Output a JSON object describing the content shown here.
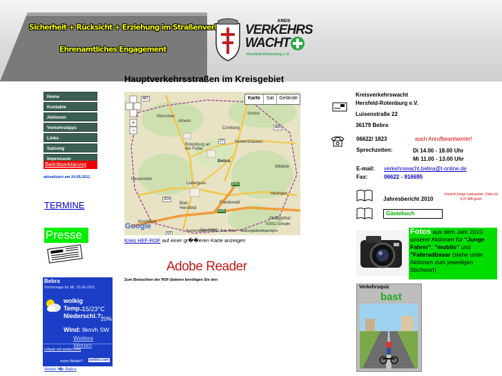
{
  "banner": {
    "slogan_line1": "Sicherheit + Rücksicht + Erziehung im Straßenverkehr",
    "slogan_line2": "Ehrenamtliches Engagement",
    "logo": {
      "small_text": "KREIS",
      "word1": "VERKEHRS",
      "word2": "WACHT",
      "sub": "Hersfeld-Rotenburg e.V.",
      "accent": "#2ea84a",
      "brand": "#1a1a1a"
    }
  },
  "nav": {
    "items": [
      "Home",
      "Kontakte",
      "Aktionen",
      "Verkehrstipps",
      "Links",
      "Satzung",
      "Impressum"
    ],
    "beitritt": "Beitrittserklärung",
    "updated": "aktualisiert am 24.05.2011",
    "termine": "TERMINE",
    "presse": "Presse"
  },
  "weather": {
    "city": "Bebra",
    "forecast_title": "Vorhersage für Mi. 15.06.2011",
    "condition": "wolkig",
    "temp_label": "Temp.:",
    "temp_value": "15/23°C",
    "rain_label": "Niederschl.?:",
    "rain_value": "20%",
    "wind_label": "Wind:",
    "wind_value": "9km/h SW",
    "more_link": "Weitere Werte»",
    "urlaub_link": "Urlaub mit wetter.com",
    "more_weather": "mehr Wetter?",
    "brand": "wetter.com",
    "footer_link": "Wetter f�r Bebra"
  },
  "main": {
    "title": "Hauptverkehrsstraßen im Kreisgebiet",
    "map": {
      "buttons": [
        "Karte",
        "Sat",
        "Gelände"
      ],
      "places": [
        "Morschen",
        "Alheim",
        "Sontra",
        "Cornberg",
        "Nentershausen",
        "Rotenburg an der Fulda",
        "Bebra",
        "Neuenstein",
        "Ludwigsau",
        "Bad Hersfeld",
        "Friedewald",
        "Wildeck",
        "Heringen",
        "Philippsthal",
        "Kirchheim",
        "Haunetal"
      ],
      "roads": [
        "487",
        "27",
        "400",
        "324",
        "E45",
        "E40",
        "62",
        "7",
        "4"
      ],
      "copyright": "Kartendaten ©2011 Tele Atlas - Nutzungsbedingungen",
      "google": "Google",
      "google_right": "©2011 Google"
    },
    "caption_link": "Kreis HEF-ROF",
    "caption_rest": " auf einer gr��eren Karte anzeigen",
    "adobe": "Adobe Reader",
    "pdf_note": "Zum Betrachten der PDF-Dateien benötigen Sie den"
  },
  "contact": {
    "org1": "Kreisverkehrswacht",
    "org2": "Hersfeld-Rotenburg e.V.",
    "street": "Luisenstraße 22",
    "city": "36179 Bebra",
    "phone": "06622/ 1823",
    "answering": "auch Anrufbeantworter!",
    "hours_label": "Sprechzeiten:",
    "hours1": "Di 14.00 - 18.00 Uhr",
    "hours2": "Mi 11.00 - 13.00 Uhr",
    "email_label": "E-mail:",
    "email": "verkehrswacht.bebra@t-online.de",
    "fax_label": "Fax:",
    "fax": "06622 - 916695",
    "warning": "Vorsicht lange Ladezeiten: Datei ist 9,07 MB groß!",
    "report": "Jahresbericht 2010",
    "guestbook": "Gästebuch"
  },
  "fotos": {
    "word": "Fotos",
    "text1": " aus dem Jahr 2010 unserer Aktionen für ",
    "q1": "\"Junge Fahrer\"",
    "sep": ", ",
    "q2": "\"mobilo\"",
    "und": " und ",
    "q3": "\"Fahrradbasar",
    "text2": " (siehe unter Aktionen zum jeweiligen Stichwort)"
  },
  "quiz": {
    "title": "Verkehrsquiz",
    "label": "bast",
    "accent": "#22aa22"
  }
}
